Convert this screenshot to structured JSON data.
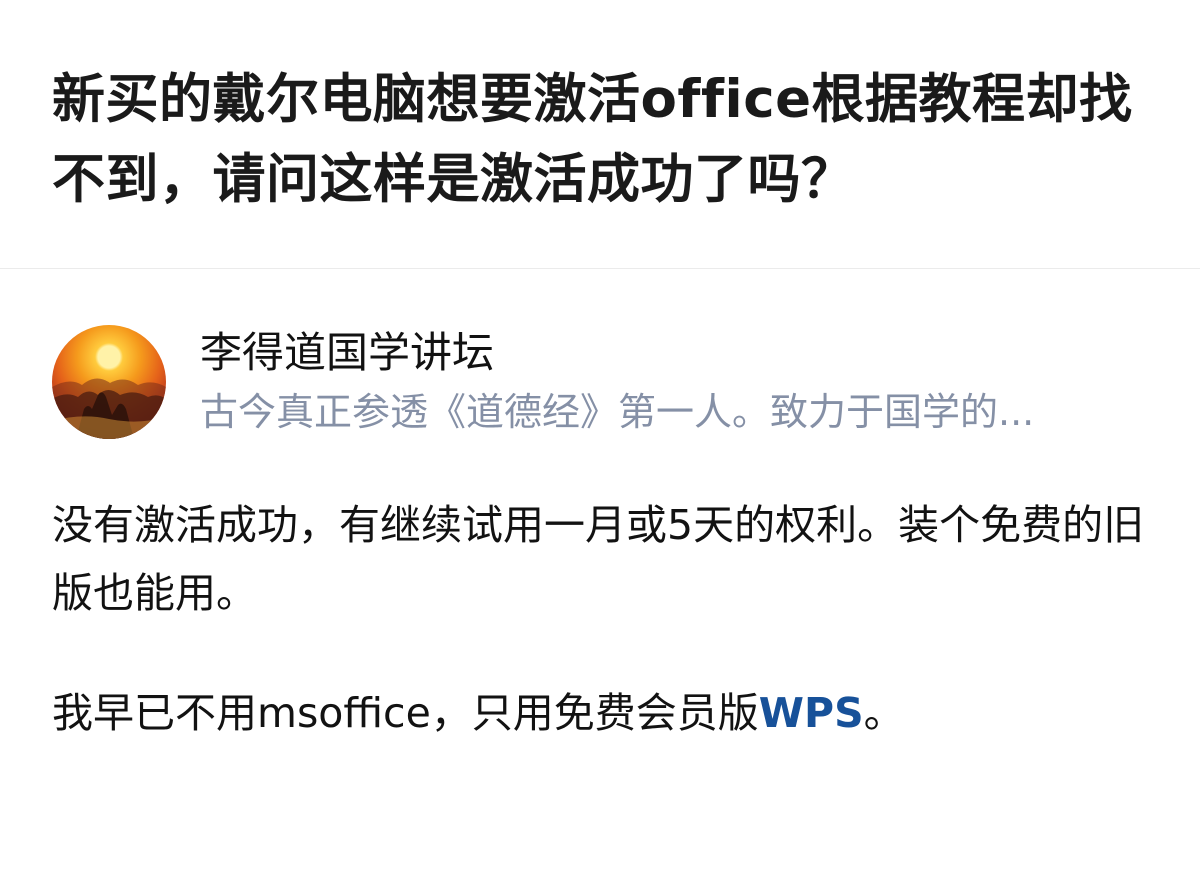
{
  "question": {
    "title": "新买的戴尔电脑想要激活office根据教程却找不到，请问这样是激活成功了吗？"
  },
  "answer": {
    "author": {
      "avatar_icon": "sunset-mountain-avatar",
      "name": "李得道国学讲坛",
      "bio": "古今真正参透《道德经》第一人。致力于国学的..."
    },
    "paragraph1": "没有激活成功，有继续试用一月或5天的权利。装个免费的旧版也能用。",
    "paragraph2": {
      "before_link": "我早已不用msoffice，只用免费会员版",
      "link_text": "WPS",
      "after_link": "。"
    }
  },
  "colors": {
    "link": "#175199",
    "bio": "#8590a6",
    "text": "#121212"
  }
}
